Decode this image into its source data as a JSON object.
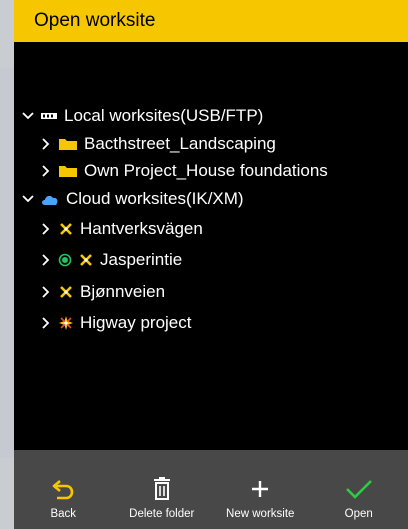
{
  "title": "Open worksite",
  "tree": {
    "local_group": {
      "label": "Local worksites(USB/FTP)",
      "items": [
        {
          "label": "Bacthstreet_Landscaping"
        },
        {
          "label": "Own Project_House foundations"
        }
      ]
    },
    "cloud_group": {
      "label": "Cloud worksites(IK/XM)",
      "items": [
        {
          "label": "Hantverksvägen",
          "active": false
        },
        {
          "label": "Jasperintie",
          "active": true
        },
        {
          "label": "Bjønnveien",
          "active": false
        },
        {
          "label": "Higway project",
          "active": false
        }
      ]
    }
  },
  "toolbar": {
    "back": "Back",
    "delete_folder": "Delete folder",
    "new_worksite": "New worksite",
    "open": "Open"
  },
  "colors": {
    "accent": "#f6c700",
    "active_green": "#22c55e",
    "cloud_blue": "#4aa3ff",
    "open_green": "#2ecc40"
  }
}
